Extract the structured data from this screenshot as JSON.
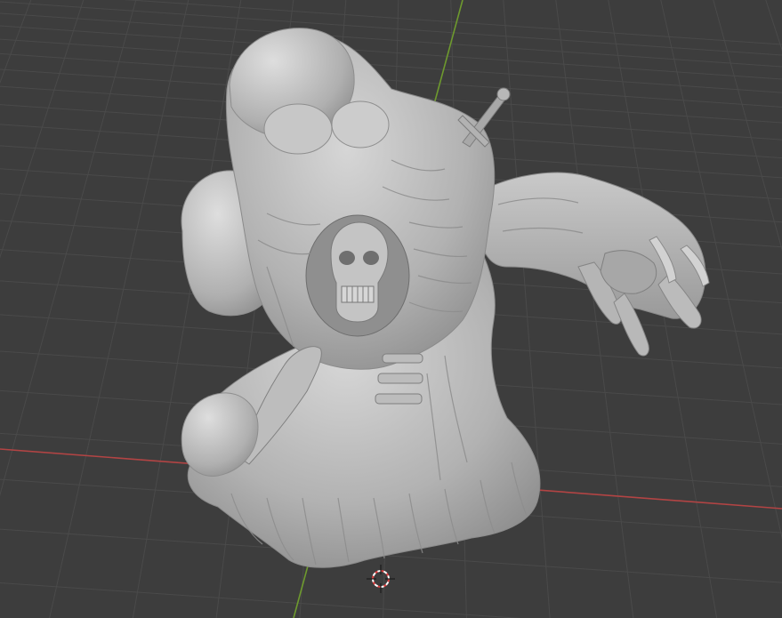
{
  "app": {
    "name": "3D Viewport"
  },
  "viewport": {
    "background_color": "#3d3d3d",
    "grid_color": "#4a4a4a",
    "x_axis_color": "#b24444",
    "y_axis_color": "#6e9a2e",
    "cursor_color_a": "#e04040",
    "cursor_color_b": "#ffffff"
  },
  "model": {
    "description_icon": "sculpt-mesh-icon",
    "base_color": "#b9b9b9",
    "shadow_color": "#6e6e6e",
    "highlight_color": "#d9d9d9"
  },
  "cursor": {
    "icon": "3d-cursor-icon"
  }
}
